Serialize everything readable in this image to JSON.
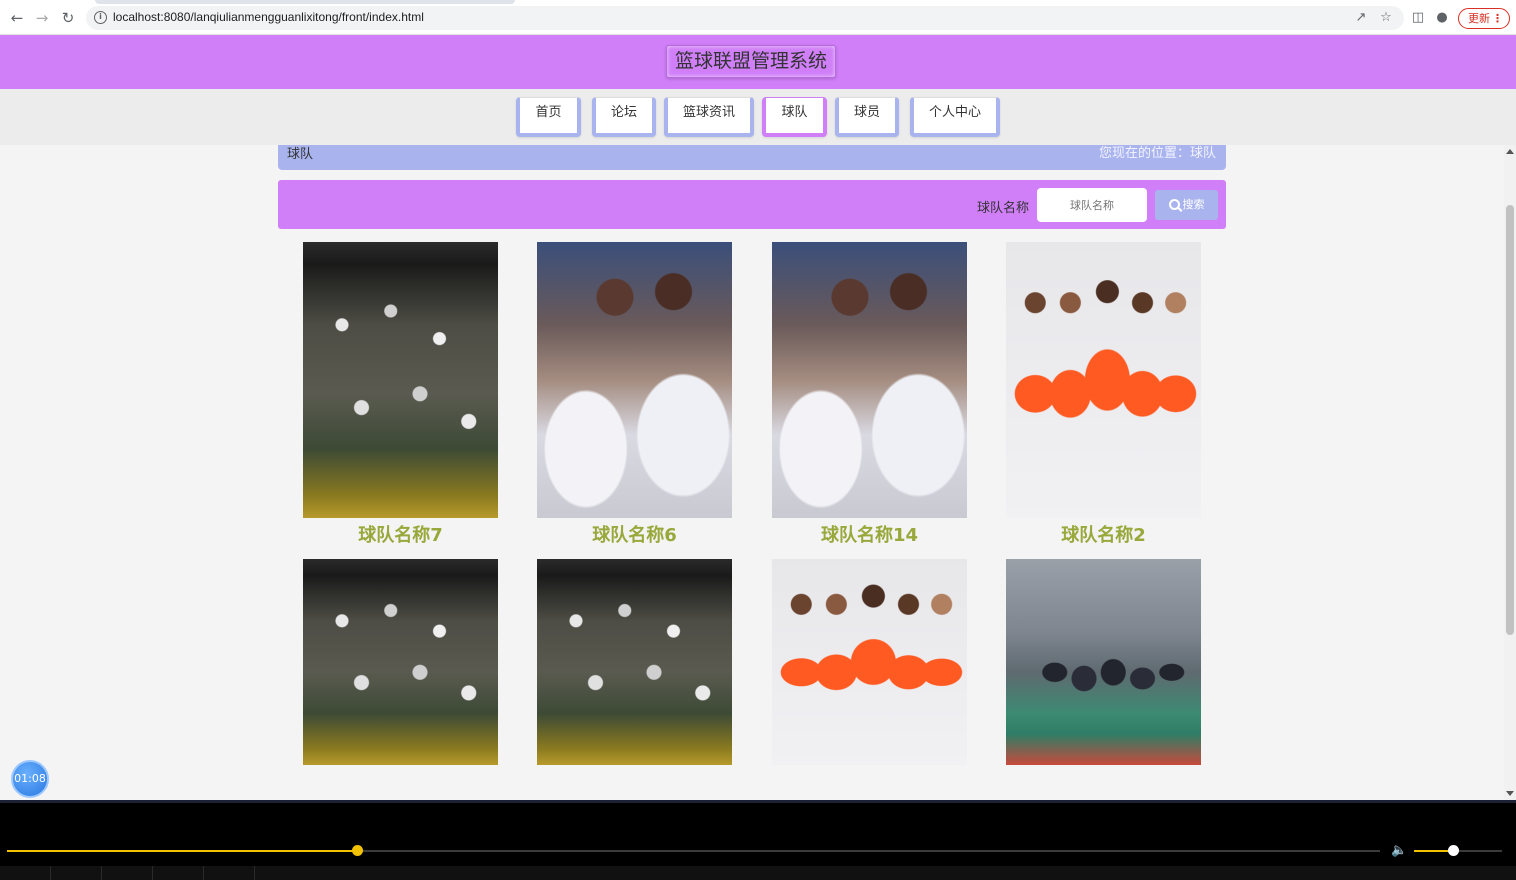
{
  "browser": {
    "url": "localhost:8080/lanqiulianmengguanlixitong/front/index.html",
    "update_label": "更新",
    "icons": [
      "back-icon",
      "forward-icon",
      "reload-icon",
      "info-icon",
      "share-icon",
      "star-icon",
      "sidebar-icon",
      "profile-icon",
      "menu-dots-icon"
    ]
  },
  "site": {
    "title": "篮球联盟管理系统",
    "nav": [
      {
        "label": "首页",
        "active": false
      },
      {
        "label": "论坛",
        "active": false
      },
      {
        "label": "篮球资讯",
        "active": false
      },
      {
        "label": "球队",
        "active": true
      },
      {
        "label": "球员",
        "active": false
      },
      {
        "label": "个人中心",
        "active": false
      }
    ]
  },
  "breadcrumb": {
    "current": "球队",
    "location": "您现在的位置：球队"
  },
  "search": {
    "label": "球队名称",
    "placeholder": "球队名称",
    "button_label": "搜索"
  },
  "teams": [
    {
      "name": "球队名称7",
      "photo": "crowd"
    },
    {
      "name": "球队名称6",
      "photo": "huddle"
    },
    {
      "name": "球队名称14",
      "photo": "huddle"
    },
    {
      "name": "球队名称2",
      "photo": "orange"
    },
    {
      "name": "",
      "photo": "crowd"
    },
    {
      "name": "",
      "photo": "crowd"
    },
    {
      "name": "",
      "photo": "orange"
    },
    {
      "name": "",
      "photo": "court"
    }
  ],
  "overlay": {
    "timer": "01:08"
  },
  "player": {
    "progress": 0.255,
    "volume": 0.44
  },
  "colors": {
    "accent": "#d07ff8",
    "secondary": "#a9b4ee",
    "team_name": "#98a83a",
    "seek": "#f2c200"
  }
}
